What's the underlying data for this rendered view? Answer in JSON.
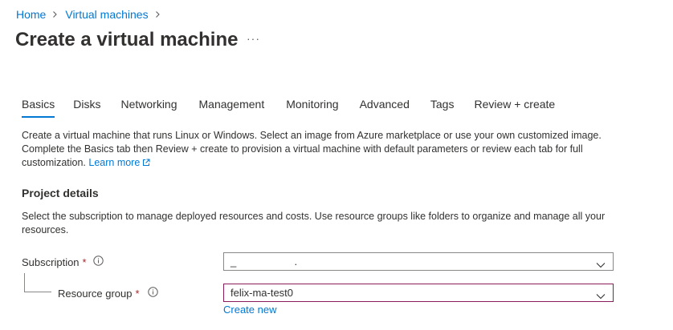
{
  "breadcrumb": {
    "items": [
      {
        "label": "Home"
      },
      {
        "label": "Virtual machines"
      }
    ]
  },
  "page": {
    "title": "Create a virtual machine",
    "more_label": "···"
  },
  "tabs": [
    {
      "label": "Basics",
      "active": true
    },
    {
      "label": "Disks"
    },
    {
      "label": "Networking"
    },
    {
      "label": "Management"
    },
    {
      "label": "Monitoring"
    },
    {
      "label": "Advanced"
    },
    {
      "label": "Tags"
    },
    {
      "label": "Review + create"
    }
  ],
  "intro": {
    "text": "Create a virtual machine that runs Linux or Windows. Select an image from Azure marketplace or use your own customized image. Complete the Basics tab then Review + create to provision a virtual machine with default parameters or review each tab for full customization.",
    "learn_more": "Learn more"
  },
  "project_details": {
    "heading": "Project details",
    "description": "Select the subscription to manage deployed resources and costs. Use resource groups like folders to organize and manage all your resources.",
    "subscription": {
      "label": "Subscription",
      "required_mark": "*",
      "value": "_                    ."
    },
    "resource_group": {
      "label": "Resource group",
      "required_mark": "*",
      "value": "felix-ma-test0",
      "create_new": "Create new"
    }
  },
  "colors": {
    "accent": "#0078d4",
    "focus_border": "#8a1c5c",
    "required": "#a4262c"
  },
  "icons": {
    "breadcrumb_separator": "chevron-right-icon",
    "external_link": "external-link-icon",
    "info": "info-icon",
    "dropdown": "chevron-down-icon"
  }
}
